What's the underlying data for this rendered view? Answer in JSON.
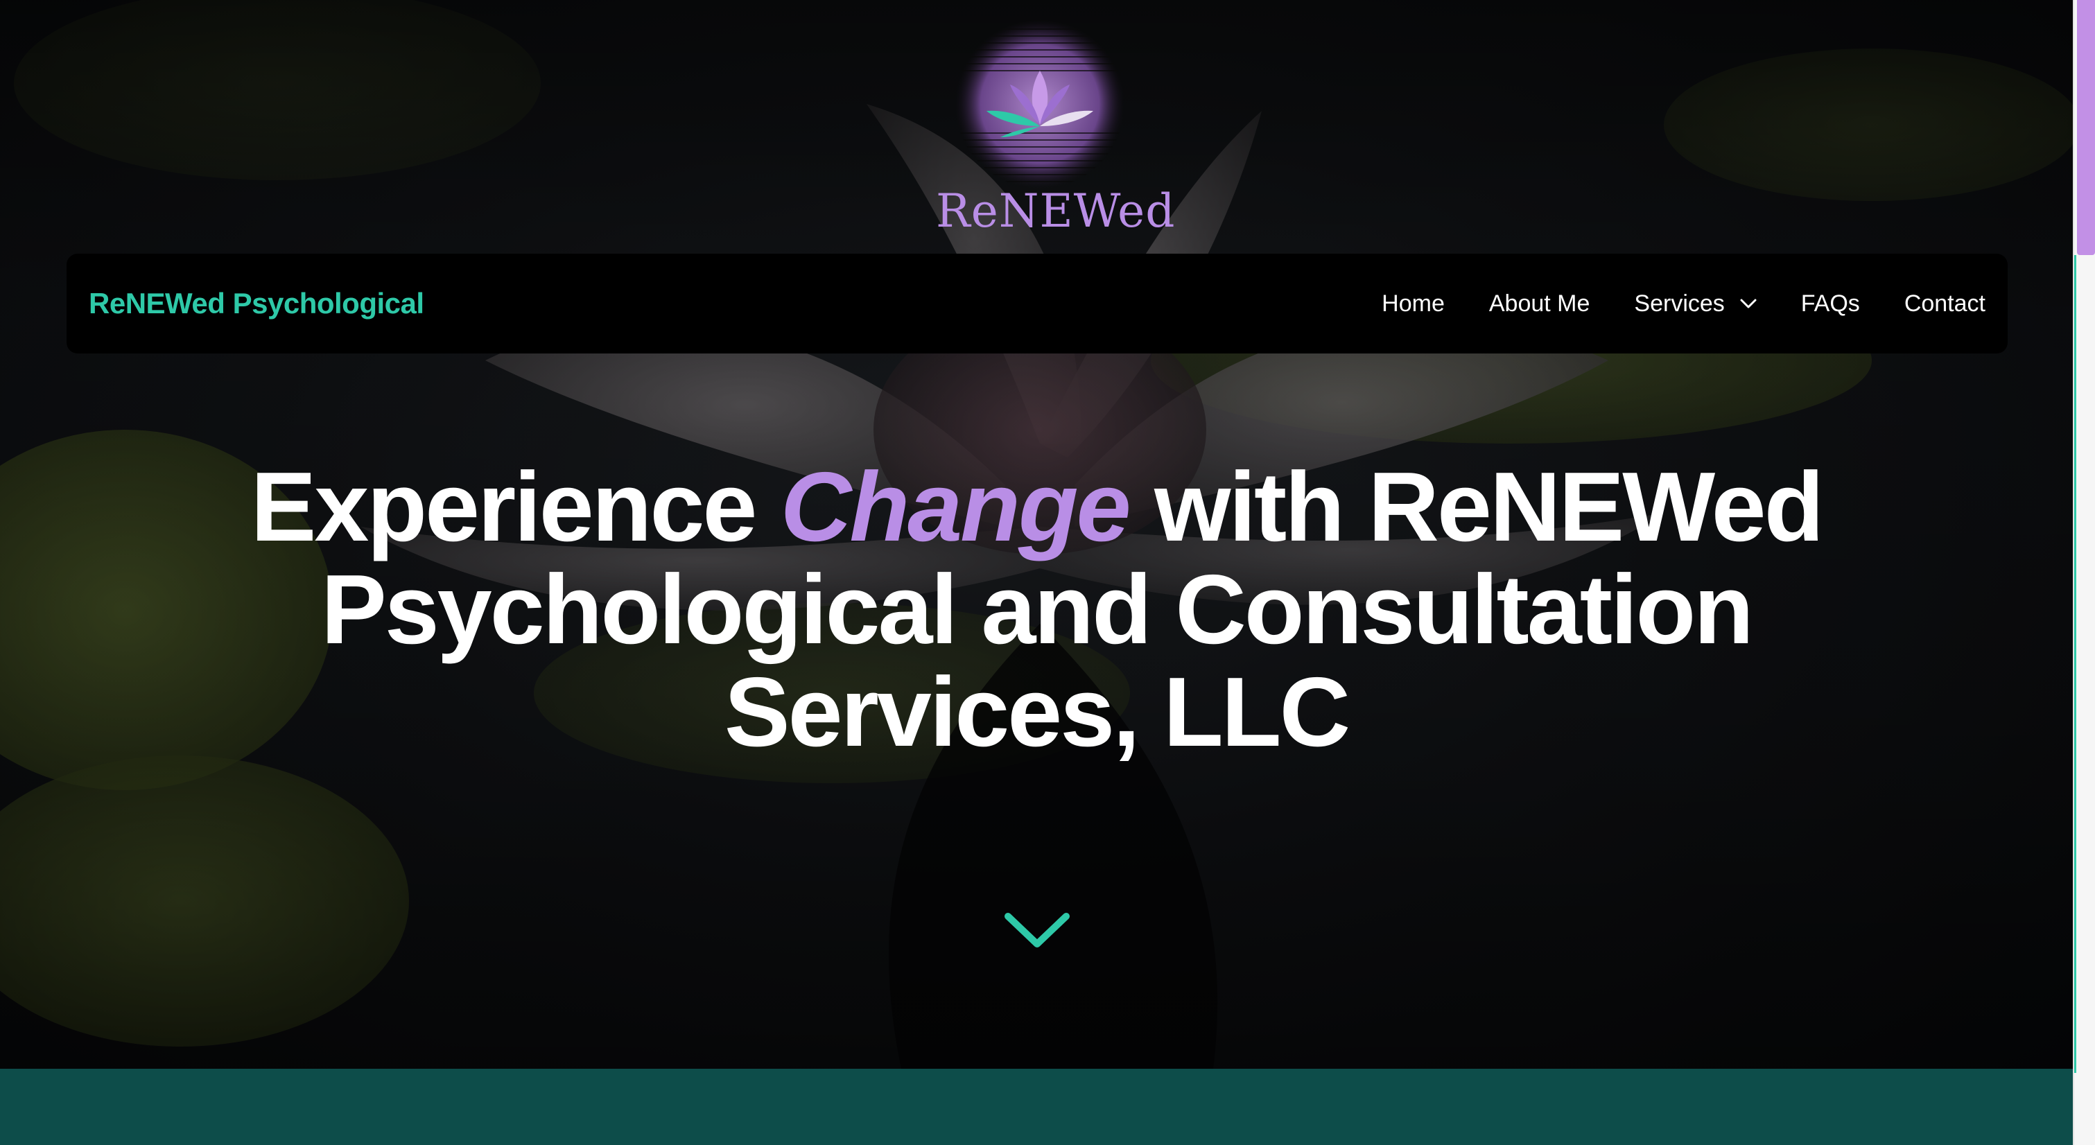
{
  "logo": {
    "wordmark": "ReNEWed"
  },
  "nav": {
    "brand": "ReNEWed Psychological",
    "links": [
      {
        "label": "Home"
      },
      {
        "label": "About Me"
      },
      {
        "label": "Services",
        "has_dropdown": true
      },
      {
        "label": "FAQs"
      },
      {
        "label": "Contact"
      }
    ]
  },
  "hero": {
    "headline_part1": "Experience ",
    "headline_accent": "Change",
    "headline_part2": " with ReNEWed Psychological and Consultation Services, LLC"
  },
  "colors": {
    "brand_teal": "#2ec9a8",
    "accent_purple": "#b98ee6",
    "strip_teal": "#0d4d4a",
    "navbar": "#000000"
  },
  "icons": [
    "lotus-logo-icon",
    "chevron-down-icon",
    "scroll-down-chevron-icon"
  ]
}
